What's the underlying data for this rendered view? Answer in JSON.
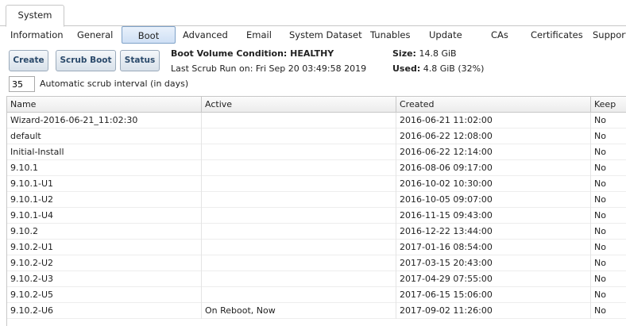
{
  "top_tab": "System",
  "subnav": [
    "Information",
    "General",
    "Boot",
    "Advanced",
    "Email",
    "System Dataset",
    "Tunables",
    "Update",
    "CAs",
    "Certificates",
    "Support"
  ],
  "buttons": {
    "create": "Create",
    "scrub_boot": "Scrub Boot",
    "status": "Status"
  },
  "boot_info": {
    "condition_label": "Boot Volume Condition: HEALTHY",
    "last_scrub": "Last Scrub Run on: Fri Sep 20 03:49:58 2019",
    "size_label": "Size:",
    "size_value": "14.8 GiB",
    "used_label": "Used:",
    "used_value": "4.8 GiB (32%)"
  },
  "scrub_interval": {
    "value": "35",
    "label": "Automatic scrub interval (in days)"
  },
  "table": {
    "columns": [
      "Name",
      "Active",
      "Created",
      "Keep"
    ],
    "rows": [
      [
        "Wizard-2016-06-21_11:02:30",
        "",
        "2016-06-21 11:02:00",
        "No"
      ],
      [
        "default",
        "",
        "2016-06-22 12:08:00",
        "No"
      ],
      [
        "Initial-Install",
        "",
        "2016-06-22 12:14:00",
        "No"
      ],
      [
        "9.10.1",
        "",
        "2016-08-06 09:17:00",
        "No"
      ],
      [
        "9.10.1-U1",
        "",
        "2016-10-02 10:30:00",
        "No"
      ],
      [
        "9.10.1-U2",
        "",
        "2016-10-05 09:07:00",
        "No"
      ],
      [
        "9.10.1-U4",
        "",
        "2016-11-15 09:43:00",
        "No"
      ],
      [
        "9.10.2",
        "",
        "2016-12-22 13:44:00",
        "No"
      ],
      [
        "9.10.2-U1",
        "",
        "2017-01-16 08:54:00",
        "No"
      ],
      [
        "9.10.2-U2",
        "",
        "2017-03-15 20:43:00",
        "No"
      ],
      [
        "9.10.2-U3",
        "",
        "2017-04-29 07:55:00",
        "No"
      ],
      [
        "9.10.2-U5",
        "",
        "2017-06-15 15:06:00",
        "No"
      ],
      [
        "9.10.2-U6",
        "On Reboot, Now",
        "2017-09-02 11:26:00",
        "No"
      ]
    ]
  }
}
